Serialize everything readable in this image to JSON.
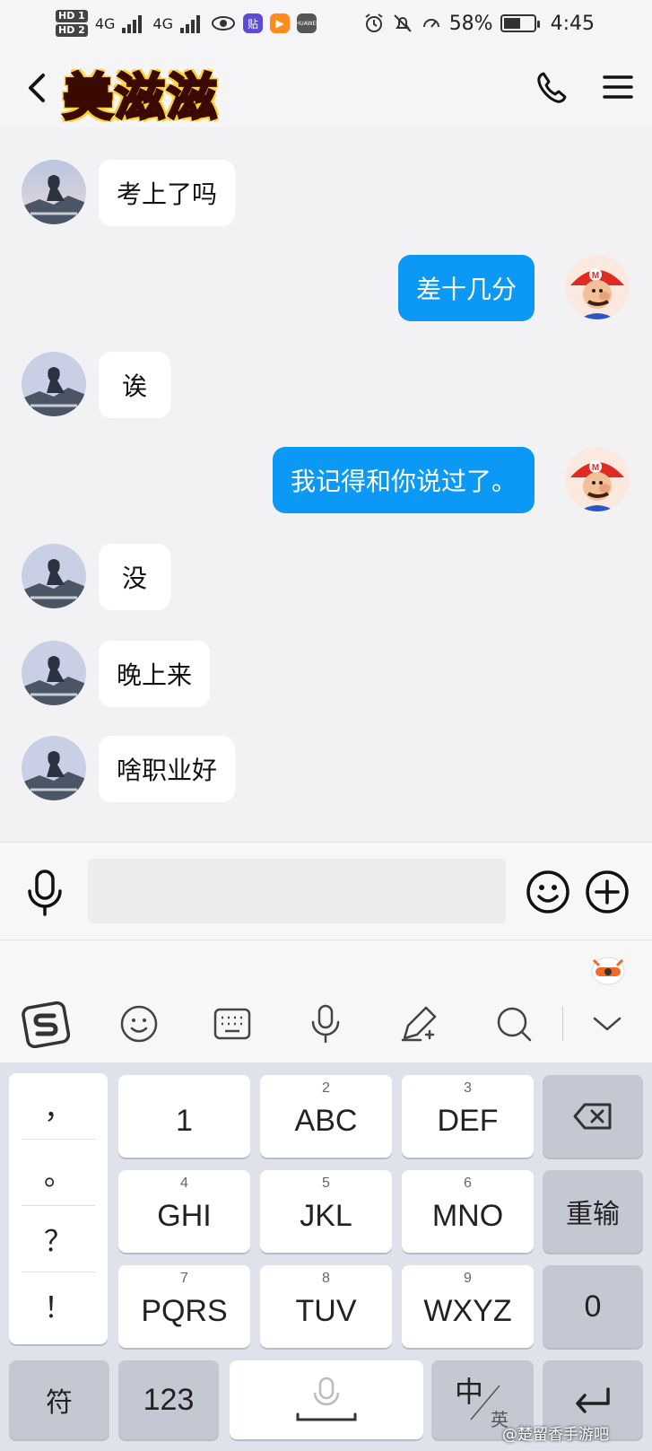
{
  "status_bar": {
    "network_1": "HD 1",
    "network_2": "HD 2",
    "net_type": "4G",
    "app_badge": "贴",
    "brand_badge": "HUAWEI",
    "battery_percent": "58%",
    "battery_level": 0.58,
    "time": "4:45"
  },
  "header": {
    "title": "美滋滋",
    "icons": [
      "back-icon",
      "phone-icon",
      "menu-icon"
    ]
  },
  "messages": [
    {
      "side": "in",
      "text": "考上了吗"
    },
    {
      "side": "out",
      "text": "差十几分"
    },
    {
      "side": "in",
      "text": "诶"
    },
    {
      "side": "out",
      "text": "我记得和你说过了。"
    },
    {
      "side": "in",
      "text": "没"
    },
    {
      "side": "in",
      "text": "晚上来"
    },
    {
      "side": "in",
      "text": "啥职业好"
    }
  ],
  "input_bar": {
    "placeholder": "",
    "value": "",
    "icons": [
      "microphone-icon",
      "emoji-icon",
      "plus-icon"
    ]
  },
  "ime_toolbar": [
    "sogou-logo-icon",
    "emoji-icon",
    "keyboard-icon",
    "voice-icon",
    "handwriting-icon",
    "search-icon",
    "collapse-icon"
  ],
  "keyboard": {
    "punctuation": [
      "，",
      "。",
      "？",
      "！"
    ],
    "row1": [
      {
        "label": "1",
        "sub": ""
      },
      {
        "label": "ABC",
        "sub": "2"
      },
      {
        "label": "DEF",
        "sub": "3"
      }
    ],
    "row2": [
      {
        "label": "GHI",
        "sub": "4"
      },
      {
        "label": "JKL",
        "sub": "5"
      },
      {
        "label": "MNO",
        "sub": "6"
      }
    ],
    "row3": [
      {
        "label": "PQRS",
        "sub": "7"
      },
      {
        "label": "TUV",
        "sub": "8"
      },
      {
        "label": "WXYZ",
        "sub": "9"
      }
    ],
    "right_keys": {
      "delete": "delete-icon",
      "reinput": "重输",
      "zero": "0"
    },
    "bottom": {
      "symbols": "符",
      "numbers": "123",
      "lang_main": "中",
      "lang_sub": "英",
      "enter": "enter-icon"
    }
  },
  "watermark": "@楚留香手游吧",
  "colors": {
    "accent": "#0c99f5",
    "keyboard_bg": "#dfe2eb"
  }
}
